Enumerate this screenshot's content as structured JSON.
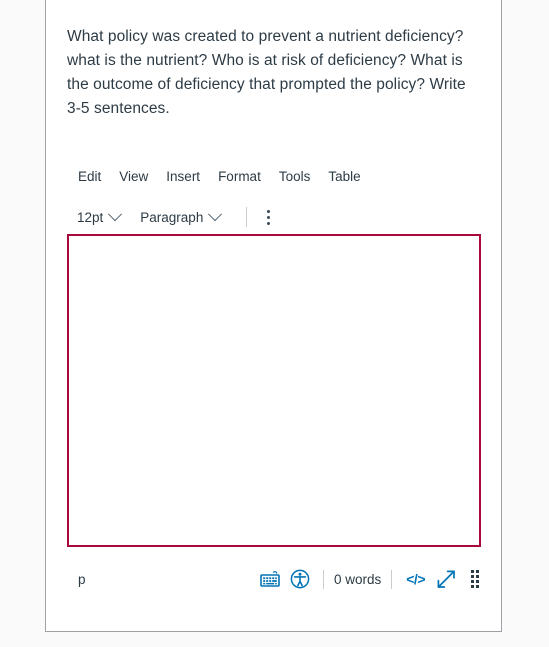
{
  "question": {
    "text": "What policy was created to prevent a nutrient deficiency? what is the nutrient? Who is at risk of deficiency?  What is the outcome of deficiency that prompted the policy? Write 3-5 sentences."
  },
  "editor": {
    "menubar": [
      {
        "label": "Edit"
      },
      {
        "label": "View"
      },
      {
        "label": "Insert"
      },
      {
        "label": "Format"
      },
      {
        "label": "Tools"
      },
      {
        "label": "Table"
      }
    ],
    "toolbar": {
      "font_size": "12pt",
      "block_format": "Paragraph",
      "more_options": "more-options"
    },
    "body": {
      "content": "",
      "border_color": "#a9093a"
    },
    "statusbar": {
      "element_path": "p",
      "keyboard_shortcuts_label": "keyboard-shortcuts",
      "accessibility_checker_label": "accessibility-checker",
      "word_count": "0 words",
      "html_editor_label": "</>",
      "fullscreen_label": "fullscreen",
      "resize_label": "resize-handle"
    }
  },
  "colors": {
    "accent": "#0374b5",
    "focus_border": "#a9093a",
    "text": "#2d3b45",
    "divider": "#c7cdd1",
    "card_border": "#9ea2a6"
  }
}
